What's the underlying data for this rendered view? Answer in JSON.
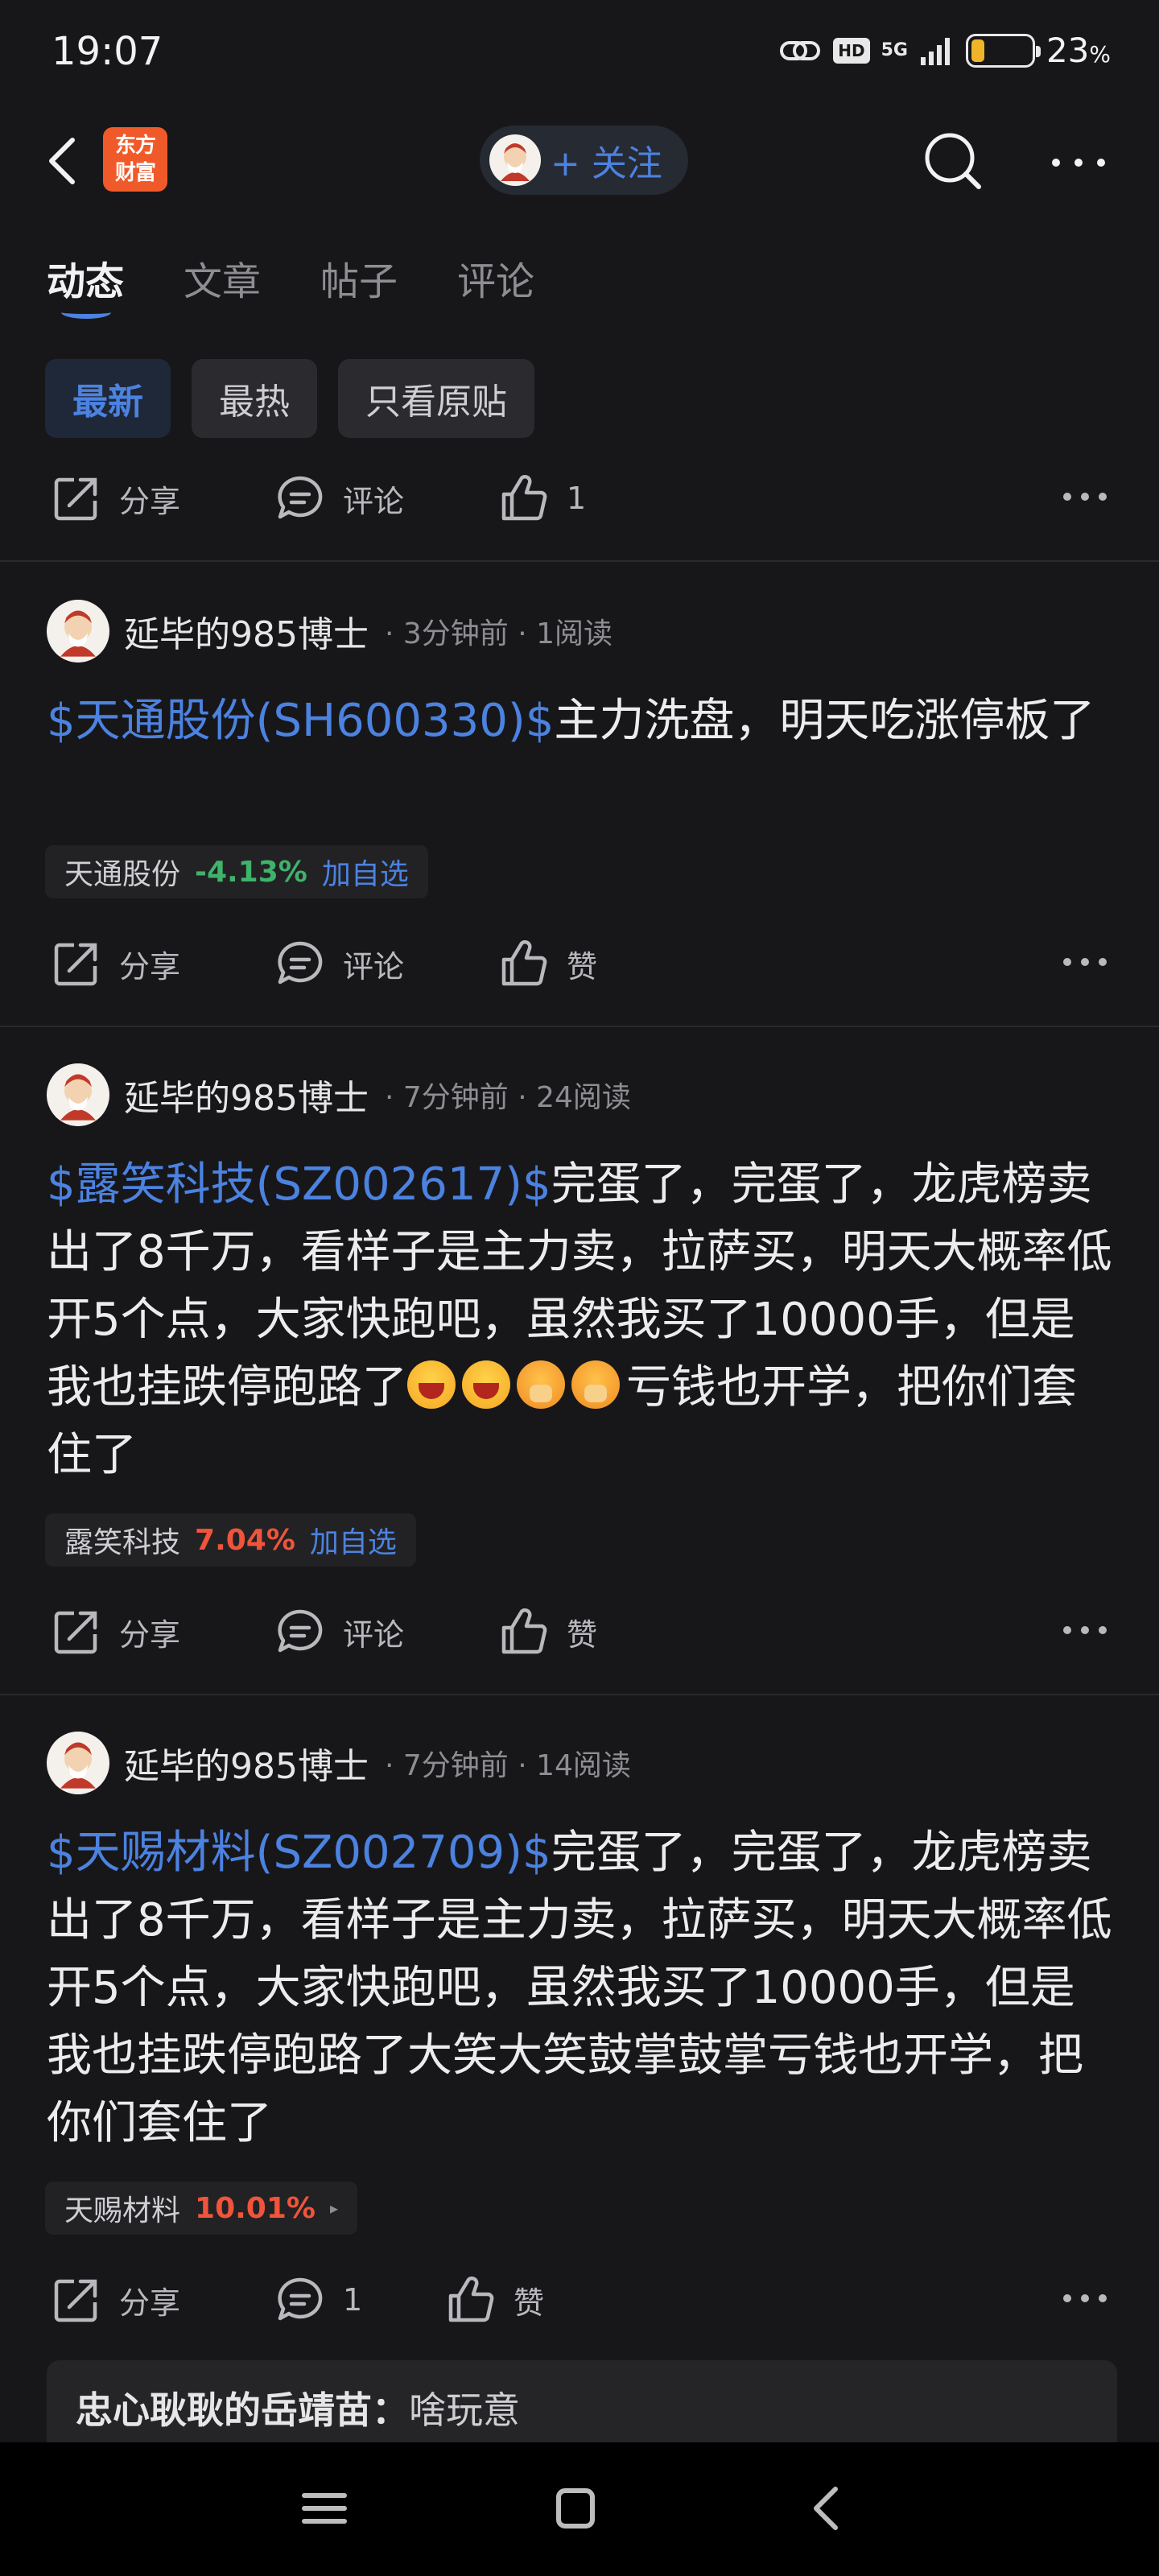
{
  "status_bar": {
    "time": "19:07",
    "hd": "HD",
    "network": "5G",
    "battery_percent": "23",
    "battery_unit": "%"
  },
  "header": {
    "logo_line1": "东方",
    "logo_line2": "财富",
    "follow_label": "+ 关注"
  },
  "tabs": [
    {
      "label": "动态",
      "active": true
    },
    {
      "label": "文章",
      "active": false
    },
    {
      "label": "帖子",
      "active": false
    },
    {
      "label": "评论",
      "active": false
    }
  ],
  "filters": [
    {
      "label": "最新",
      "active": true
    },
    {
      "label": "最热",
      "active": false
    },
    {
      "label": "只看原贴",
      "active": false
    }
  ],
  "top_actions": {
    "share": "分享",
    "comment": "评论",
    "like": "1"
  },
  "posts": [
    {
      "author": "延毕的985博士",
      "time": "3分钟前",
      "reads": "1阅读",
      "stock_link": "$天通股份(SH600330)$",
      "text": "主力洗盘，明天吃涨停板了",
      "chip": {
        "name": "天通股份",
        "change": "-4.13%",
        "add": "加自选"
      },
      "actions": {
        "share": "分享",
        "comment": "评论",
        "like": "赞"
      }
    },
    {
      "author": "延毕的985博士",
      "time": "7分钟前",
      "reads": "24阅读",
      "stock_link": "$露笑科技(SZ002617)$",
      "text": "完蛋了，完蛋了，龙虎榜卖出了8千万，看样子是主力卖，拉萨买，明天大概率低开5个点，大家快跑吧，虽然我买了10000手，但是我也挂跌停跑路了",
      "text_after": "亏钱也开学，把你们套住了",
      "chip": {
        "name": "露笑科技",
        "change": "7.04%",
        "add": "加自选"
      },
      "actions": {
        "share": "分享",
        "comment": "评论",
        "like": "赞"
      }
    },
    {
      "author": "延毕的985博士",
      "time": "7分钟前",
      "reads": "14阅读",
      "stock_link": "$天赐材料(SZ002709)$",
      "text": "完蛋了，完蛋了，龙虎榜卖出了8千万，看样子是主力卖，拉萨买，明天大概率低开5个点，大家快跑吧，虽然我买了10000手，但是我也挂跌停跑路了大笑大笑鼓掌鼓掌亏钱也开学，把你们套住了",
      "chip": {
        "name": "天赐材料",
        "change": "10.01%",
        "arrow": "▸"
      },
      "actions": {
        "share": "分享",
        "comment": "1",
        "like": "赞"
      }
    }
  ],
  "comment_preview": {
    "user": "忠心耿耿的岳靖苗：",
    "text": "啥玩意"
  },
  "colors": {
    "background": "#17171a",
    "accent": "#4c82e0",
    "down": "#3fb36a",
    "up": "#f0543a"
  }
}
